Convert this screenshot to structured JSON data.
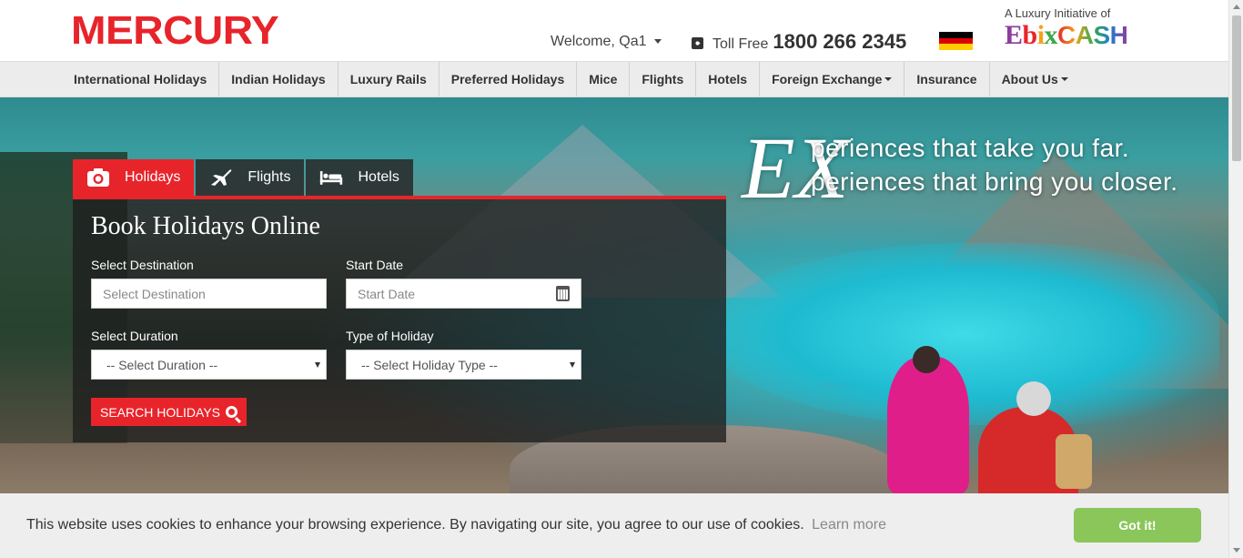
{
  "header": {
    "logo_text": "MERCURY",
    "welcome": "Welcome, Qa1",
    "toll_free_label": "Toll Free",
    "toll_free_number": "1800 266 2345",
    "flag_icon": "germany-flag-icon",
    "ebix_tagline": "A Luxury Initiative of",
    "ebix_logo": {
      "e": "E",
      "b": "b",
      "i": "i",
      "x": "x",
      "cash": "CASH"
    }
  },
  "nav": {
    "items": [
      {
        "label": "International Holidays"
      },
      {
        "label": "Indian Holidays"
      },
      {
        "label": "Luxury Rails"
      },
      {
        "label": "Preferred Holidays"
      },
      {
        "label": "Mice"
      },
      {
        "label": "Flights"
      },
      {
        "label": "Hotels"
      },
      {
        "label": "Foreign Exchange"
      },
      {
        "label": "Insurance"
      },
      {
        "label": "About Us"
      }
    ]
  },
  "hero": {
    "tag_x": "EX",
    "tag_line1": "periences that take you far.",
    "tag_line2": "periences that bring you closer."
  },
  "booking": {
    "tabs": [
      {
        "label": "Holidays",
        "icon": "camera-icon"
      },
      {
        "label": "Flights",
        "icon": "airplane-icon"
      },
      {
        "label": "Hotels",
        "icon": "bed-icon"
      }
    ],
    "title": "Book Holidays Online",
    "destination_label": "Select Destination",
    "destination_placeholder": "Select Destination",
    "start_date_label": "Start Date",
    "start_date_placeholder": "Start Date",
    "duration_label": "Select Duration",
    "duration_value": "-- Select Duration --",
    "type_label": "Type of Holiday",
    "type_value": "-- Select Holiday Type --",
    "search_button": "SEARCH HOLIDAYS"
  },
  "cookie": {
    "text": "This website uses cookies to enhance your browsing experience. By navigating our site, you agree to our use of cookies.",
    "link": "Learn more",
    "button": "Got it!"
  },
  "colors": {
    "brand_red": "#e8242b",
    "nav_bg": "#ececec",
    "cookie_button": "#8ac65a"
  }
}
